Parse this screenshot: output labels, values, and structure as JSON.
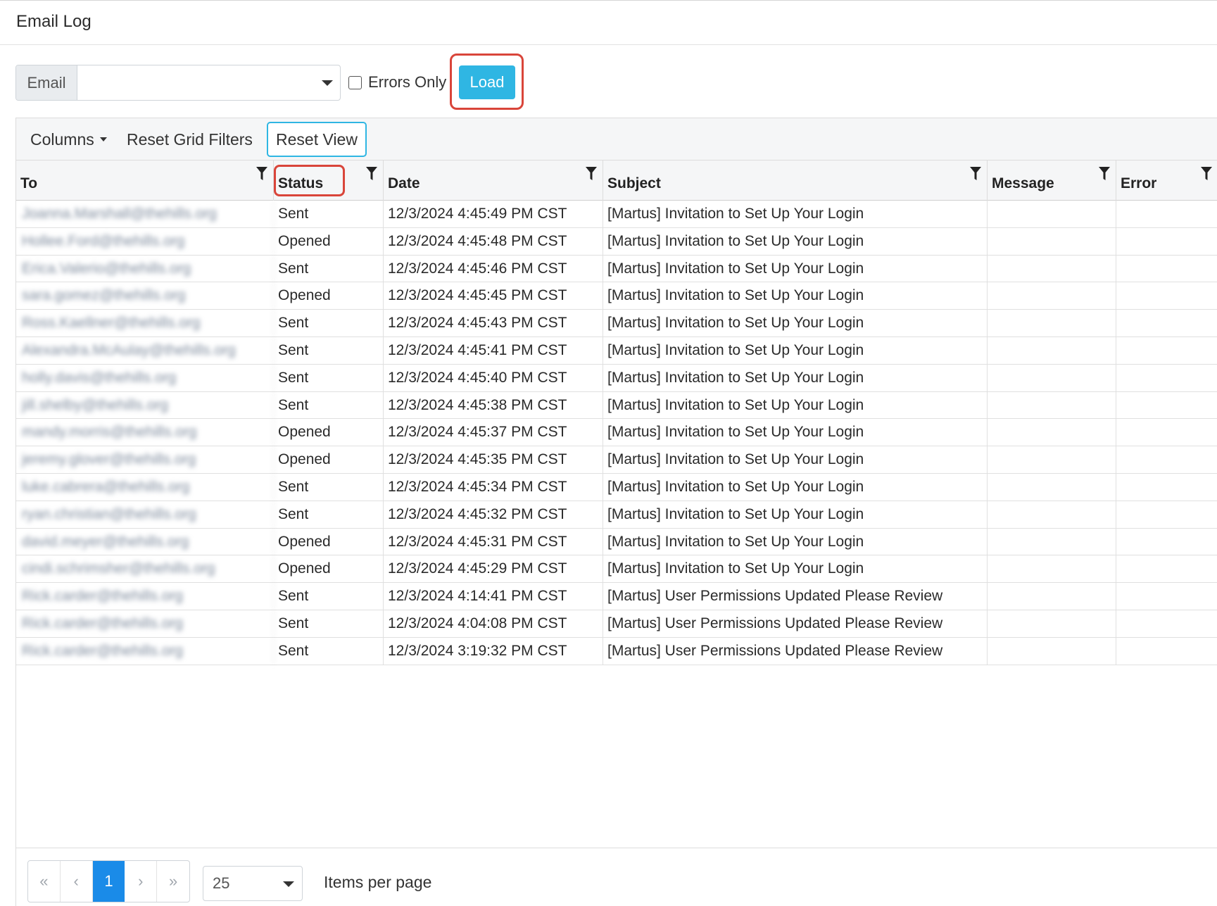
{
  "page": {
    "title": "Email Log"
  },
  "filters": {
    "email_label": "Email",
    "email_value": "",
    "errors_only_label": "Errors Only",
    "errors_only_checked": false,
    "load_label": "Load"
  },
  "toolbar": {
    "columns_label": "Columns",
    "reset_filters_label": "Reset Grid Filters",
    "reset_view_label": "Reset View"
  },
  "columns": {
    "to": "To",
    "status": "Status",
    "date": "Date",
    "subject": "Subject",
    "message": "Message",
    "error": "Error"
  },
  "rows": [
    {
      "to": "Joanna.Marshall@thehills.org",
      "status": "Sent",
      "date": "12/3/2024 4:45:49 PM CST",
      "subject": "[Martus] Invitation to Set Up Your Login",
      "message": "",
      "error": ""
    },
    {
      "to": "Hollee.Ford@thehills.org",
      "status": "Opened",
      "date": "12/3/2024 4:45:48 PM CST",
      "subject": "[Martus] Invitation to Set Up Your Login",
      "message": "",
      "error": ""
    },
    {
      "to": "Erica.Valerio@thehills.org",
      "status": "Sent",
      "date": "12/3/2024 4:45:46 PM CST",
      "subject": "[Martus] Invitation to Set Up Your Login",
      "message": "",
      "error": ""
    },
    {
      "to": "sara.gomez@thehills.org",
      "status": "Opened",
      "date": "12/3/2024 4:45:45 PM CST",
      "subject": "[Martus] Invitation to Set Up Your Login",
      "message": "",
      "error": ""
    },
    {
      "to": "Ross.Kaellner@thehills.org",
      "status": "Sent",
      "date": "12/3/2024 4:45:43 PM CST",
      "subject": "[Martus] Invitation to Set Up Your Login",
      "message": "",
      "error": ""
    },
    {
      "to": "Alexandra.McAulay@thehills.org",
      "status": "Sent",
      "date": "12/3/2024 4:45:41 PM CST",
      "subject": "[Martus] Invitation to Set Up Your Login",
      "message": "",
      "error": ""
    },
    {
      "to": "holly.davis@thehills.org",
      "status": "Sent",
      "date": "12/3/2024 4:45:40 PM CST",
      "subject": "[Martus] Invitation to Set Up Your Login",
      "message": "",
      "error": ""
    },
    {
      "to": "jill.shelby@thehills.org",
      "status": "Sent",
      "date": "12/3/2024 4:45:38 PM CST",
      "subject": "[Martus] Invitation to Set Up Your Login",
      "message": "",
      "error": ""
    },
    {
      "to": "mandy.morris@thehills.org",
      "status": "Opened",
      "date": "12/3/2024 4:45:37 PM CST",
      "subject": "[Martus] Invitation to Set Up Your Login",
      "message": "",
      "error": ""
    },
    {
      "to": "jeremy.glover@thehills.org",
      "status": "Opened",
      "date": "12/3/2024 4:45:35 PM CST",
      "subject": "[Martus] Invitation to Set Up Your Login",
      "message": "",
      "error": ""
    },
    {
      "to": "luke.cabrera@thehills.org",
      "status": "Sent",
      "date": "12/3/2024 4:45:34 PM CST",
      "subject": "[Martus] Invitation to Set Up Your Login",
      "message": "",
      "error": ""
    },
    {
      "to": "ryan.christian@thehills.org",
      "status": "Sent",
      "date": "12/3/2024 4:45:32 PM CST",
      "subject": "[Martus] Invitation to Set Up Your Login",
      "message": "",
      "error": ""
    },
    {
      "to": "david.meyer@thehills.org",
      "status": "Opened",
      "date": "12/3/2024 4:45:31 PM CST",
      "subject": "[Martus] Invitation to Set Up Your Login",
      "message": "",
      "error": ""
    },
    {
      "to": "cindi.schrimsher@thehills.org",
      "status": "Opened",
      "date": "12/3/2024 4:45:29 PM CST",
      "subject": "[Martus] Invitation to Set Up Your Login",
      "message": "",
      "error": ""
    },
    {
      "to": "Rick.carder@thehills.org",
      "status": "Sent",
      "date": "12/3/2024 4:14:41 PM CST",
      "subject": "[Martus] User Permissions Updated Please Review",
      "message": "",
      "error": ""
    },
    {
      "to": "Rick.carder@thehills.org",
      "status": "Sent",
      "date": "12/3/2024 4:04:08 PM CST",
      "subject": "[Martus] User Permissions Updated Please Review",
      "message": "",
      "error": ""
    },
    {
      "to": "Rick.carder@thehills.org",
      "status": "Sent",
      "date": "12/3/2024 3:19:32 PM CST",
      "subject": "[Martus] User Permissions Updated Please Review",
      "message": "",
      "error": ""
    }
  ],
  "pager": {
    "first": "«",
    "prev": "‹",
    "current_page": "1",
    "next": "›",
    "last": "»",
    "page_size": "25",
    "items_per_page_label": "Items per page"
  },
  "colors": {
    "accent": "#2fb6e3",
    "active_page": "#1a8be8",
    "highlight": "#d9453a"
  }
}
